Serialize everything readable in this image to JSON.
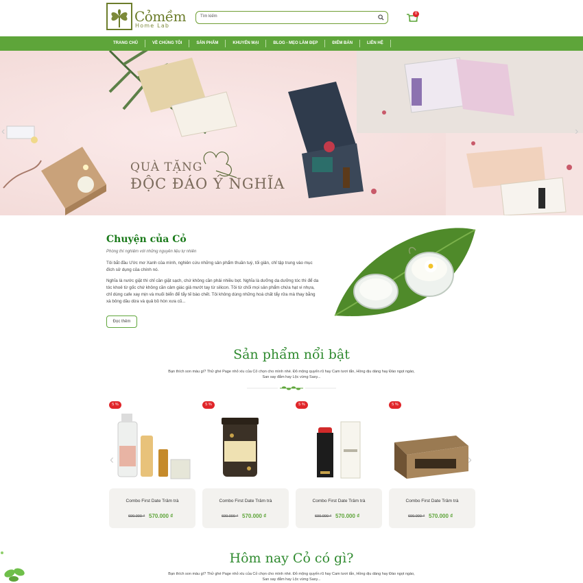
{
  "header": {
    "logo_title": "Cỏmềm",
    "logo_subtitle": "Home Lab",
    "search_placeholder": "Tìm kiếm",
    "cart_count": "0"
  },
  "nav": {
    "items": [
      "Trang chủ",
      "Về chúng tôi",
      "Sản phẩm",
      "Khuyến mại",
      "Blog - Mẹo làm đẹp",
      "Điểm bán",
      "Liên hệ"
    ]
  },
  "banner": {
    "line1": "QUÀ TẶNG",
    "line2": "ĐỘC ĐÁO Ý NGHĨA"
  },
  "story": {
    "title": "Chuyện của Cỏ",
    "subtitle": "Phòng thí nghiệm với những nguyên liệu tự nhiên",
    "para1": "Tôi bắt đầu Ước mơ Xanh của mình, nghiên cứu những sản phẩm thuần tuý, tối giản, chỉ tập trung vào mục đích sử dụng của chính nó.",
    "para2": "Nghĩa là nước giặt thì chỉ cần giặt sạch, chứ không cần phải nhiều bọt. Nghĩa là dưỡng da dưỡng tóc thì để da tóc khoẻ từ gốc chứ không cần cảm giác giả mướt tay từ silicon. Tôi từ chối mọi sản phẩm chứa hạt vi nhựa, chỉ dùng cafe xay mịn và muối biển để tẩy tế bào chết. Tôi không dùng những hoá chất tẩy rửa mà thay bằng xà bông dầu dừa và quả bồ hòn xưa cũ...",
    "button": "Đọc thêm"
  },
  "featured": {
    "title": "Sản phẩm nổi bật",
    "subtitle": "Bạn thích son màu gì? Thử ghé Page nhỏ xíu của Cỏ chọn cho mình nhé. Đỏ mộng quyến rũ hay Cam tươi tắn, Hồng dịu dàng hay Đào ngọt ngào, San say đắm hay Lộc vừng Saxy..."
  },
  "products": [
    {
      "badge": "5 %",
      "name": "Combo First Date Trâm trà",
      "old_price": "600.000 ₫",
      "price": "570.000 ₫"
    },
    {
      "badge": "5 %",
      "name": "Combo First Date Trâm trà",
      "old_price": "600.000 ₫",
      "price": "570.000 ₫"
    },
    {
      "badge": "5 %",
      "name": "Combo First Date Trâm trà",
      "old_price": "600.000 ₫",
      "price": "570.000 ₫"
    },
    {
      "badge": "5 %",
      "name": "Combo First Date Trâm trà",
      "old_price": "600.000 ₫",
      "price": "570.000 ₫"
    }
  ],
  "today": {
    "title": "Hôm nay Cỏ có gì?",
    "subtitle": "Bạn thích son màu gì? Thử ghé Page nhỏ xíu của Cỏ chọn cho mình nhé. Đỏ mộng quyến rũ hay Cam tươi tắn, Hồng dịu dàng hay Đào ngọt ngào, San say đắm hay Lộc vừng Saxy..."
  },
  "colors": {
    "brand_green": "#5ea53a",
    "heading_green": "#2f8a2f",
    "sale_red": "#e0262a"
  },
  "icons": [
    "clover-logo-icon",
    "search-icon",
    "cart-icon",
    "chevron-left-icon",
    "chevron-right-icon",
    "leaf-divider-icon"
  ]
}
